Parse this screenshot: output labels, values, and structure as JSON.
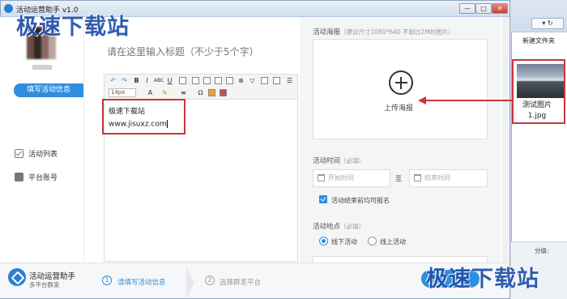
{
  "window": {
    "title": "活动运营助手 v1.0",
    "controls": {
      "minimize": "—",
      "maximize": "□",
      "close": "✕"
    }
  },
  "sidebar": {
    "fill_button": "填写活动信息",
    "items": [
      {
        "label": "活动列表",
        "icon": "checkbox-icon"
      },
      {
        "label": "平台账号",
        "icon": "user-icon"
      }
    ]
  },
  "editor": {
    "title_placeholder": "请在这里输入标题（不少于5个字）",
    "font_size": "14px",
    "lines": [
      "极速下载站",
      "www.jisuxz.com"
    ]
  },
  "poster": {
    "label": "活动海报",
    "hint": "（建议尺寸1080*640 不超过2M的图片）",
    "upload_label": "上传海报"
  },
  "time": {
    "label": "活动时间",
    "hint": "（必填）",
    "start_placeholder": "开始时间",
    "to": "至",
    "end_placeholder": "结束时间"
  },
  "signup": {
    "label": "活动结束前均可报名",
    "checked": true
  },
  "location": {
    "label": "活动地点",
    "hint": "（必填）",
    "options": [
      "线下活动",
      "线上活动"
    ],
    "selected": "线下活动"
  },
  "footer": {
    "brand_name": "活动运营助手",
    "brand_sub": "多平台群发",
    "steps": [
      {
        "num": "1",
        "label": "请填写活动信息",
        "active": true
      },
      {
        "num": "2",
        "label": "选择群发平台",
        "active": false
      }
    ]
  },
  "explorer": {
    "nav": "▾ ↻",
    "new_folder": "新建文件夹",
    "file_name_line1": "测试图片",
    "file_name_line2": "1.jpg",
    "bottom_label": "分级:"
  },
  "watermark": "极速下载站",
  "colors": {
    "accent": "#2f8ee0",
    "highlight": "#c8363b",
    "watermark": "#1f4fa8"
  }
}
